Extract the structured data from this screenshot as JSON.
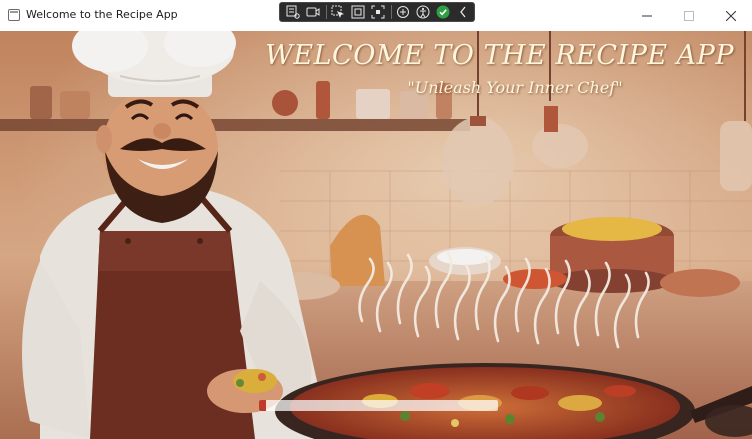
{
  "window": {
    "title": "Welcome to the Recipe App"
  },
  "debug_toolbar": {
    "buttons": [
      "live-visual-tree-icon",
      "record-icon",
      "select-element-icon",
      "display-layout-adorners-icon",
      "track-focus-icon",
      "binding-failures-icon",
      "accessibility-icon",
      "hot-reload-check-icon",
      "collapse-icon"
    ]
  },
  "splash": {
    "title": "WELCOME TO THE RECIPE APP",
    "tagline": "\"Unleash Your Inner Chef\"",
    "progress": 0.03,
    "accent_color": "#c0392b"
  }
}
